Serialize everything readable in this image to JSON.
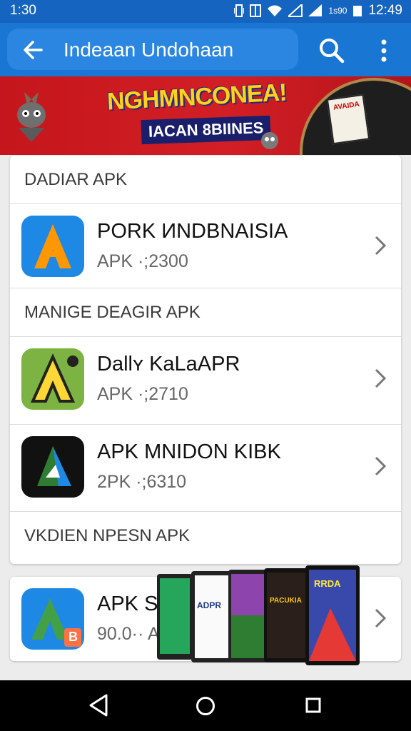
{
  "status_bar": {
    "time_left": "1:30",
    "small_text": "1ѕ90",
    "time_right": "12:49",
    "icons": [
      "vibrate-icon",
      "nfc-icon",
      "wifi-icon",
      "signal-icon",
      "signal-icon",
      "battery-icon"
    ]
  },
  "app_bar": {
    "title": "Indeaan Undohaan",
    "icons": [
      "back-arrow-icon",
      "search-icon",
      "more-vert-icon"
    ]
  },
  "banner": {
    "title": "NGHMNCONEA!",
    "subtitle": "IACAN 8BIINES",
    "card_text": "AVAIDA"
  },
  "sections": [
    {
      "header": "DADIAR APK",
      "items": [
        {
          "name": "PORK ИNDBNAISIA",
          "sub": "APK ·;2300",
          "icon": "orange-a-icon"
        }
      ]
    },
    {
      "header": "MANIGE DEAGIR APK",
      "items": [
        {
          "name": "Dallʏ KaLaAPR",
          "sub": "APK ·;2710",
          "icon": "green-yellow-a-icon"
        },
        {
          "name": "APK MNIDON KIBK",
          "sub": "2PK ·;6310",
          "icon": "black-green-a-icon"
        }
      ]
    },
    {
      "header": "VKDIEN NPESN APK",
      "items": []
    }
  ],
  "bottom_item": {
    "name": "APK S",
    "sub": "90.0·· A",
    "badge": "B",
    "icon": "green-a-badge-icon"
  },
  "phones_text": {
    "p2": "ADPR",
    "p4": "PACUKIA",
    "p5": "RRDA"
  },
  "nav_bar": {
    "icons": [
      "nav-back-icon",
      "nav-home-icon",
      "nav-recents-icon"
    ]
  },
  "colors": {
    "app_bar": "#1976d2",
    "status_bar": "#1565c0",
    "banner": "#c4161c",
    "banner_title": "#ffd21a"
  }
}
